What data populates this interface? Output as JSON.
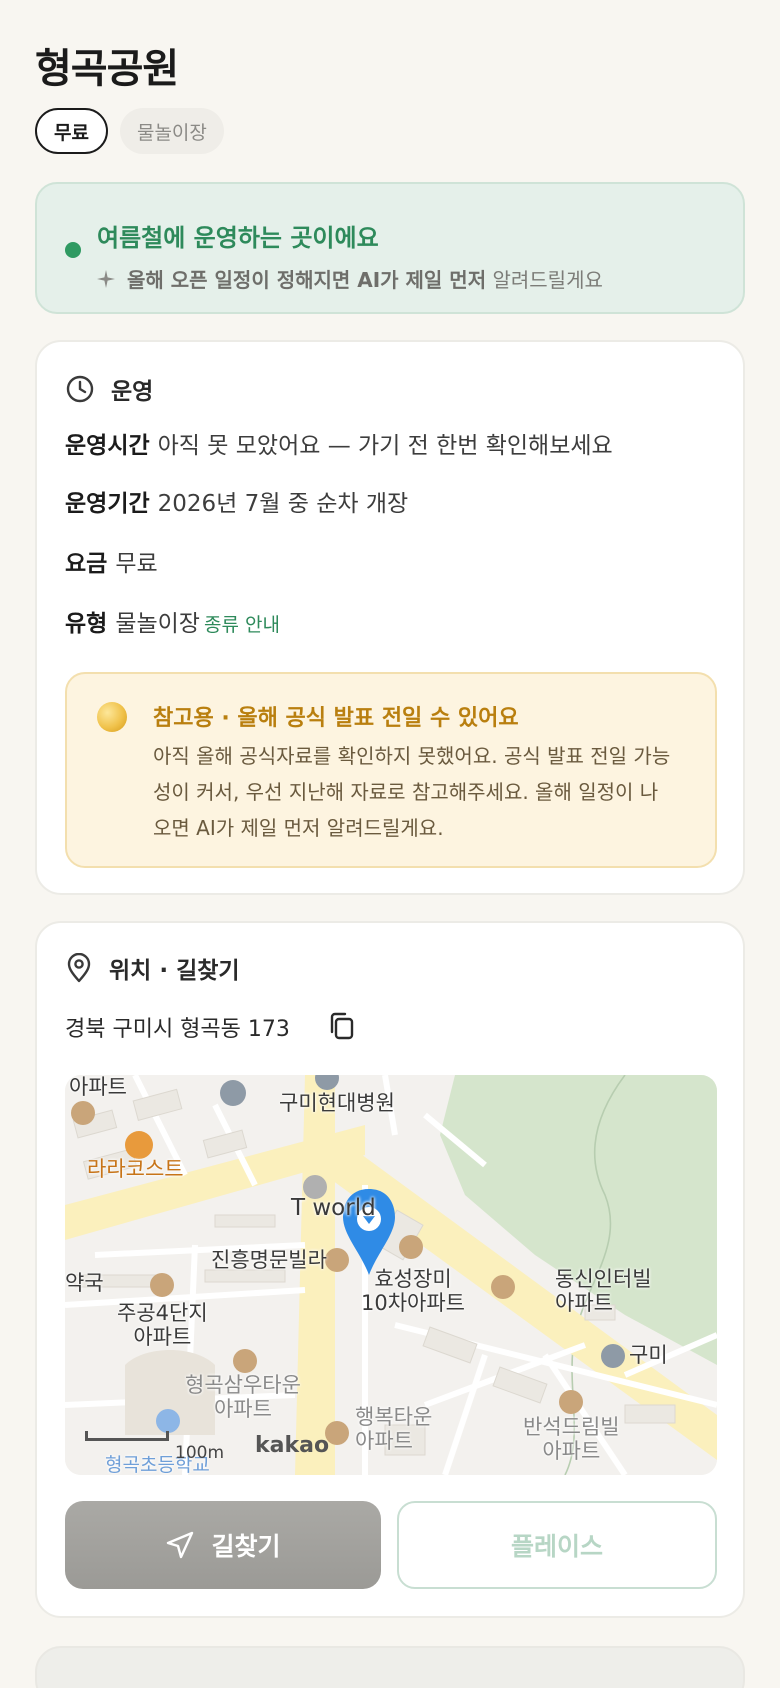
{
  "place": {
    "title": "형곡공원"
  },
  "chips": [
    {
      "label": "무료"
    },
    {
      "label": "물놀이장"
    }
  ],
  "summer_banner": {
    "title": "여름철에 운영하는 곳이에요",
    "sub_bold": "올해 오픈 일정이 정해지면 AI가 제일 먼저",
    "sub_rest": "알려드릴게요",
    "accent": "#2f9a62"
  },
  "operation": {
    "section_title": "운영",
    "rows": [
      {
        "key": "운영시간",
        "value": "아직 못 모았어요 — 가기 전 한번 확인해보세요"
      },
      {
        "key": "운영기간",
        "value": "2026년 7월 중 순차 개장"
      },
      {
        "key": "요금",
        "value": "무료"
      },
      {
        "key": "유형",
        "value": "물놀이장",
        "link": "종류 안내"
      }
    ],
    "notice": {
      "title": "참고용 · 올해 공식 발표 전일 수 있어요",
      "body": "아직 올해 공식자료를 확인하지 못했어요. 공식 발표 전일 가능성이 커서, 우선 지난해 자료로 참고해주세요. 올해 일정이 나오면 AI가 제일 먼저 알려드릴게요."
    }
  },
  "location": {
    "section_title": "위치 · 길찾기",
    "address": "경북 구미시 형곡동 173",
    "map": {
      "labels": {
        "apt_top": "아파트",
        "hospital": "구미현대병원",
        "restaurant": "라라코스트",
        "tworld": "T world",
        "villa": "진흥명문빌라",
        "pharmacy": "약국",
        "hyosung_1": "효성장미",
        "hyosung_2": "10차아파트",
        "dongsin_1": "동신인터빌",
        "dongsin_2": "아파트",
        "jugong_1": "주공4단지",
        "jugong_2": "아파트",
        "gumi": "구미",
        "samwoo_1": "형곡삼우타운",
        "samwoo_2": "아파트",
        "haengbok_1": "행복타운",
        "haengbok_2": "아파트",
        "bansuk_1": "반석드림빌",
        "bansuk_2": "아파트",
        "school": "형곡초등학교"
      },
      "scale": "100m",
      "provider": "kakao"
    },
    "buttons": {
      "directions": "길찾기",
      "place": "플레이스"
    }
  }
}
